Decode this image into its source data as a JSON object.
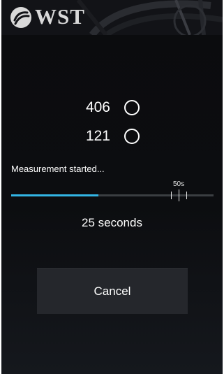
{
  "header": {
    "brand": "WST",
    "logo_icon": "wst-swirl-logo-icon"
  },
  "readings": [
    {
      "value": "406",
      "icon": "circle-outline-icon"
    },
    {
      "value": "121",
      "icon": "circle-outline-icon"
    }
  ],
  "measurement": {
    "status": "Measurement started...",
    "tick_label": "50s",
    "progress_fraction": 0.43,
    "elapsed_text": "25 seconds"
  },
  "actions": {
    "cancel_label": "Cancel"
  },
  "colors": {
    "accent": "#33b5e5",
    "background": "#0c0d10",
    "text": "#ffffff"
  }
}
